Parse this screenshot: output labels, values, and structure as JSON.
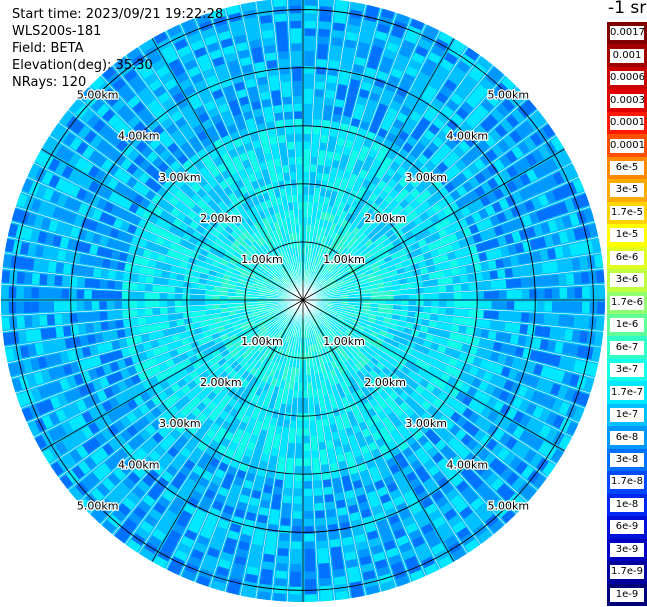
{
  "header": {
    "start_time": "Start time: 2023/09/21 19:22:28",
    "instrument": "WLS200s-181",
    "field": "Field: BETA",
    "elevation": "Elevation(deg): 35.30",
    "nrays": "NRays: 120"
  },
  "colorbar": {
    "title": "-1 sr",
    "labels": [
      "0.0017",
      "0.001",
      "0.0006",
      "0.0003",
      "0.00017",
      "0.0001",
      "6e-5",
      "3e-5",
      "1.7e-5",
      "1e-5",
      "6e-6",
      "3e-6",
      "1.7e-6",
      "1e-6",
      "6e-7",
      "3e-7",
      "1.7e-7",
      "1e-7",
      "6e-8",
      "3e-8",
      "1.7e-8",
      "1e-8",
      "6e-9",
      "3e-9",
      "1.7e-9",
      "1e-9"
    ],
    "colors": [
      "#7f0000",
      "#a00000",
      "#c80000",
      "#e00000",
      "#ff1a00",
      "#ff5000",
      "#ff8800",
      "#ffaa00",
      "#ffd200",
      "#ffff00",
      "#e0ff20",
      "#c0ff40",
      "#90ff70",
      "#60ff98",
      "#30ffc8",
      "#10ffe8",
      "#00e8ff",
      "#00c0ff",
      "#0098ff",
      "#0070ff",
      "#0048ff",
      "#0028f0",
      "#0010d8",
      "#0000c0",
      "#00009c",
      "#000078"
    ]
  },
  "chart_data": {
    "type": "heatmap",
    "projection": "polar (PPI)",
    "nrays": 120,
    "range_ring_labels": [
      "1.00km",
      "2.00km",
      "3.00km",
      "4.00km",
      "5.00km"
    ],
    "range_rings_km": [
      1,
      2,
      3,
      4,
      5
    ],
    "max_range_km": 5.2,
    "azimuth_spokes_deg": [
      0,
      30,
      60,
      90,
      120,
      150,
      180,
      210,
      240,
      270,
      300,
      330
    ],
    "colorbar_unit": "-1 sr",
    "dominant_range_by_distance": [
      {
        "range_km": [
          0,
          1.5
        ],
        "colors": [
          "#30ffc8",
          "#10ffe8",
          "#00e8ff"
        ]
      },
      {
        "range_km": [
          1.5,
          3.0
        ],
        "colors": [
          "#00e8ff",
          "#00c0ff",
          "#10ffe8"
        ]
      },
      {
        "range_km": [
          3.0,
          5.2
        ],
        "colors": [
          "#0098ff",
          "#00c0ff",
          "#0070ff",
          "#00e8ff"
        ]
      }
    ]
  }
}
